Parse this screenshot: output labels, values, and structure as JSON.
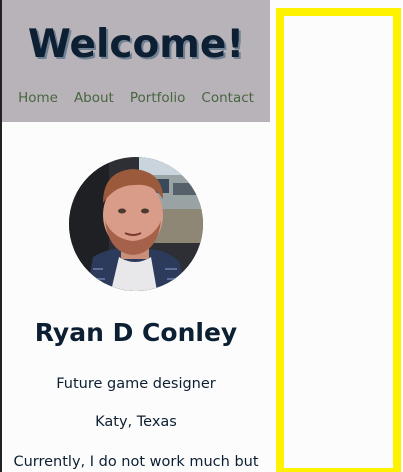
{
  "header": {
    "title": "Welcome!",
    "nav": [
      {
        "label": "Home"
      },
      {
        "label": "About"
      },
      {
        "label": "Portfolio"
      },
      {
        "label": "Contact"
      }
    ]
  },
  "profile": {
    "name": "Ryan D Conley",
    "subtitle": "Future game designer",
    "location": "Katy, Texas",
    "bio_snippet": "Currently, I do not work much but"
  },
  "colors": {
    "header_bg": "#b7b3b9",
    "title_text": "#0d2033",
    "nav_link": "#496640",
    "aside_border": "#fff200"
  }
}
